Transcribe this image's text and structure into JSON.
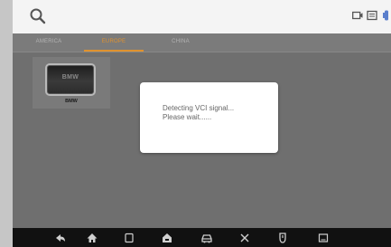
{
  "header": {
    "icons": [
      "search-icon",
      "camera-icon",
      "image-icon",
      "vci-status-icon"
    ]
  },
  "tabs": [
    {
      "label": "AMERICA",
      "active": false
    },
    {
      "label": "EUROPE",
      "active": true
    },
    {
      "label": "CHINA",
      "active": false
    }
  ],
  "brands": [
    {
      "label": "BMW",
      "logo_text": "BMW"
    }
  ],
  "dialog": {
    "line1": "Detecting VCI signal...",
    "line2": "Please wait......"
  },
  "navbar": {
    "icons": [
      "back-icon",
      "home-icon",
      "recent-apps-icon",
      "autel-home-icon",
      "vehicle-icon",
      "tools-icon",
      "vci-icon",
      "screenshot-icon"
    ]
  },
  "colors": {
    "accent": "#e0922e",
    "overlay": "#6f6f6f",
    "topbar": "#f4f4f4",
    "navbar": "#111111"
  }
}
